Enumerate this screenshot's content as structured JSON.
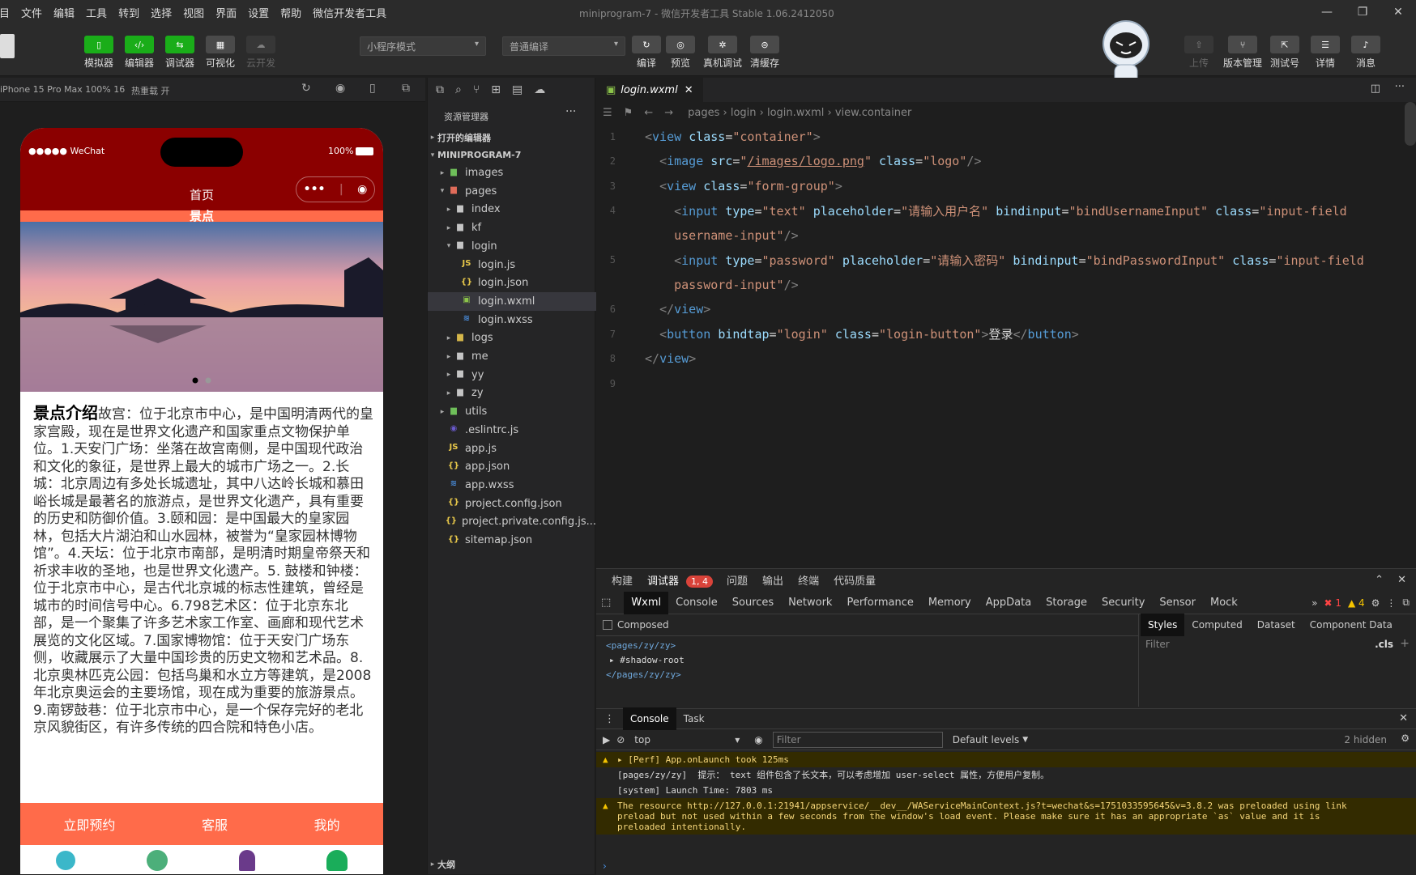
{
  "menu": [
    "项目",
    "文件",
    "编辑",
    "工具",
    "转到",
    "选择",
    "视图",
    "界面",
    "设置",
    "帮助",
    "微信开发者工具"
  ],
  "window_title": "miniprogram-7 - 微信开发者工具 Stable 1.06.2412050",
  "toolbar": {
    "left_buttons": [
      "模拟器",
      "编辑器",
      "调试器",
      "可视化",
      "云开发"
    ],
    "mode_select": "小程序模式",
    "compile_select": "普通编译",
    "mid_buttons": [
      "编译",
      "预览",
      "真机调试",
      "清缓存"
    ],
    "right_buttons": [
      "上传",
      "版本管理",
      "测试号",
      "详情",
      "消息"
    ]
  },
  "sim": {
    "device": "iPhone 15 Pro Max 100% 16",
    "hot_reload": "热重载 开",
    "status_left": "●●●●● WeChat",
    "battery": "100%",
    "nav_title": "首页",
    "section_title": "景点",
    "desc_title": "景点介绍",
    "desc_body": "故宫：位于北京市中心，是中国明清两代的皇家宫殿，现在是世界文化遗产和国家重点文物保护单位。1.天安门广场：坐落在故宫南侧，是中国现代政治和文化的象征，是世界上最大的城市广场之一。2.长城：北京周边有多处长城遗址，其中八达岭长城和慕田峪长城是最著名的旅游点，是世界文化遗产，具有重要的历史和防御价值。3.颐和园：是中国最大的皇家园林，包括大片湖泊和山水园林，被誉为“皇家园林博物馆”。4.天坛：位于北京市南部，是明清时期皇帝祭天和祈求丰收的圣地，也是世界文化遗产。5. 鼓楼和钟楼：位于北京市中心，是古代北京城的标志性建筑，曾经是城市的时间信号中心。6.798艺术区：位于北京东北部，是一个聚集了许多艺术家工作室、画廊和现代艺术展览的文化区域。7.国家博物馆：位于天安门广场东侧，收藏展示了大量中国珍贵的历史文物和艺术品。8.北京奥林匹克公园：包括鸟巢和水立方等建筑，是2008年北京奥运会的主要场馆，现在成为重要的旅游景点。9.南锣鼓巷：位于北京市中心，是一个保存完好的老北京风貌街区，有许多传统的四合院和特色小店。",
    "bottom_actions": [
      "立即预约",
      "客服",
      "我的"
    ]
  },
  "explorer": {
    "header": "资源管理器",
    "open_editors": "打开的编辑器",
    "project": "MINIPROGRAM-7",
    "items": [
      {
        "label": "images",
        "depth": 1,
        "kind": "folder-green",
        "arrow": "▸"
      },
      {
        "label": "pages",
        "depth": 1,
        "kind": "folder-red",
        "arrow": "▾"
      },
      {
        "label": "index",
        "depth": 2,
        "kind": "folder",
        "arrow": "▸"
      },
      {
        "label": "kf",
        "depth": 2,
        "kind": "folder",
        "arrow": "▸"
      },
      {
        "label": "login",
        "depth": 2,
        "kind": "folder",
        "arrow": "▾"
      },
      {
        "label": "login.js",
        "depth": 3,
        "kind": "js",
        "arrow": ""
      },
      {
        "label": "login.json",
        "depth": 3,
        "kind": "json",
        "arrow": ""
      },
      {
        "label": "login.wxml",
        "depth": 3,
        "kind": "wxml",
        "arrow": "",
        "active": true
      },
      {
        "label": "login.wxss",
        "depth": 3,
        "kind": "wxss",
        "arrow": ""
      },
      {
        "label": "logs",
        "depth": 2,
        "kind": "folder-yellow",
        "arrow": "▸"
      },
      {
        "label": "me",
        "depth": 2,
        "kind": "folder",
        "arrow": "▸"
      },
      {
        "label": "yy",
        "depth": 2,
        "kind": "folder",
        "arrow": "▸"
      },
      {
        "label": "zy",
        "depth": 2,
        "kind": "folder",
        "arrow": "▸"
      },
      {
        "label": "utils",
        "depth": 1,
        "kind": "folder-green",
        "arrow": "▸"
      },
      {
        "label": ".eslintrc.js",
        "depth": 1,
        "kind": "eslint",
        "arrow": ""
      },
      {
        "label": "app.js",
        "depth": 1,
        "kind": "js",
        "arrow": ""
      },
      {
        "label": "app.json",
        "depth": 1,
        "kind": "json",
        "arrow": ""
      },
      {
        "label": "app.wxss",
        "depth": 1,
        "kind": "wxss",
        "arrow": ""
      },
      {
        "label": "project.config.json",
        "depth": 1,
        "kind": "json",
        "arrow": ""
      },
      {
        "label": "project.private.config.js...",
        "depth": 1,
        "kind": "json",
        "arrow": ""
      },
      {
        "label": "sitemap.json",
        "depth": 1,
        "kind": "json",
        "arrow": ""
      }
    ],
    "outline": "大纲"
  },
  "editor": {
    "tab": "login.wxml",
    "breadcrumb": [
      "pages",
      "login",
      "login.wxml",
      "view.container"
    ],
    "code_lines": [
      {
        "num": "1",
        "html": "<span class=\"p\">&lt;</span><span class=\"t\">view</span> <span class=\"a\">class</span><span class=\"w\">=</span><span class=\"s\">\"container\"</span><span class=\"p\">&gt;</span>"
      },
      {
        "num": "2",
        "html": "  <span class=\"p\">&lt;</span><span class=\"t\">image</span> <span class=\"a\">src</span><span class=\"w\">=</span><span class=\"s\">\"<u>/images/logo.png</u>\"</span> <span class=\"a\">class</span><span class=\"w\">=</span><span class=\"s\">\"logo\"</span><span class=\"p\">/&gt;</span>"
      },
      {
        "num": "3",
        "html": "  <span class=\"p\">&lt;</span><span class=\"t\">view</span> <span class=\"a\">class</span><span class=\"w\">=</span><span class=\"s\">\"form-group\"</span><span class=\"p\">&gt;</span>"
      },
      {
        "num": "4",
        "html": "    <span class=\"p\">&lt;</span><span class=\"t\">input</span> <span class=\"a\">type</span><span class=\"w\">=</span><span class=\"s\">\"text\"</span> <span class=\"a\">placeholder</span><span class=\"w\">=</span><span class=\"s\">\"请输入用户名\"</span> <span class=\"a\">bindinput</span><span class=\"w\">=</span><span class=\"s\">\"bindUsernameInput\"</span> <span class=\"a\">class</span><span class=\"w\">=</span><span class=\"s\">\"input-field</span>"
      },
      {
        "num": "",
        "html": "    <span class=\"s\">username-input\"</span><span class=\"p\">/&gt;</span>"
      },
      {
        "num": "5",
        "html": "    <span class=\"p\">&lt;</span><span class=\"t\">input</span> <span class=\"a\">type</span><span class=\"w\">=</span><span class=\"s\">\"password\"</span> <span class=\"a\">placeholder</span><span class=\"w\">=</span><span class=\"s\">\"请输入密码\"</span> <span class=\"a\">bindinput</span><span class=\"w\">=</span><span class=\"s\">\"bindPasswordInput\"</span> <span class=\"a\">class</span><span class=\"w\">=</span><span class=\"s\">\"input-field</span>"
      },
      {
        "num": "",
        "html": "    <span class=\"s\">password-input\"</span><span class=\"p\">/&gt;</span>"
      },
      {
        "num": "6",
        "html": "  <span class=\"p\">&lt;/</span><span class=\"t\">view</span><span class=\"p\">&gt;</span>"
      },
      {
        "num": "7",
        "html": "  <span class=\"p\">&lt;</span><span class=\"t\">button</span> <span class=\"a\">bindtap</span><span class=\"w\">=</span><span class=\"s\">\"login\"</span> <span class=\"a\">class</span><span class=\"w\">=</span><span class=\"s\">\"login-button\"</span><span class=\"p\">&gt;</span><span class=\"w\">登录</span><span class=\"p\">&lt;/</span><span class=\"t\">button</span><span class=\"p\">&gt;</span>"
      },
      {
        "num": "8",
        "html": "<span class=\"p\">&lt;/</span><span class=\"t\">view</span><span class=\"p\">&gt;</span>"
      },
      {
        "num": "9",
        "html": ""
      }
    ]
  },
  "devtools": {
    "top_tabs": [
      "构建",
      "调试器",
      "问题",
      "输出",
      "终端",
      "代码质量"
    ],
    "badge": "1, 4",
    "panels": [
      "Wxml",
      "Console",
      "Sources",
      "Network",
      "Performance",
      "Memory",
      "AppData",
      "Storage",
      "Security",
      "Sensor",
      "Mock"
    ],
    "errors": "1",
    "warnings": "4",
    "composed": "Composed",
    "style_tabs": [
      "Styles",
      "Computed",
      "Dataset",
      "Component Data"
    ],
    "filter_placeholder": "Filter",
    "cls": ".cls",
    "wxml_lines": [
      "<pages/zy/zy>",
      "#shadow-root",
      "</pages/zy/zy>"
    ],
    "console_tabs": [
      "Console",
      "Task"
    ],
    "context": "top",
    "levels": "Default levels",
    "hidden": "2 hidden",
    "logs": [
      {
        "text": "▸ [Perf] App.onLaunch took 125ms",
        "warn": true
      },
      {
        "text": "[pages/zy/zy]  提示： text 组件包含了长文本，可以考虑增加 user-select 属性，方便用户复制。",
        "warn": false
      },
      {
        "text": "[system] Launch Time: 7803 ms",
        "warn": false
      },
      {
        "text": "The resource http://127.0.0.1:21941/appservice/__dev__/WAServiceMainContext.js?t=wechat&s=1751033595645&v=3.8.2 was preloaded using link\npreload but not used within a few seconds from the window's load event. Please make sure it has an appropriate `as` value and it is\npreloaded intentionally.",
        "warn": true
      }
    ]
  },
  "colors": {
    "accent": "#1aad19",
    "nav": "#8b0000",
    "tab": "#ff6b4a"
  }
}
